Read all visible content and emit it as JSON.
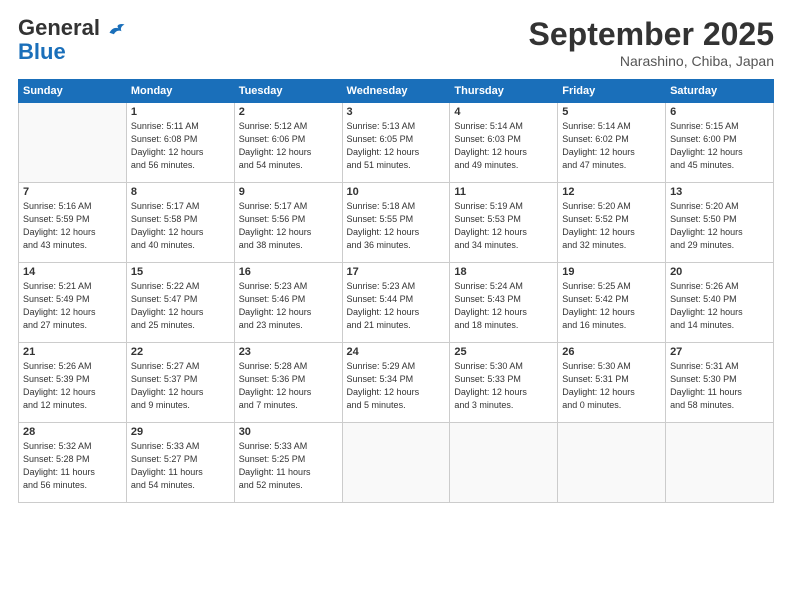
{
  "logo": {
    "general": "General",
    "blue": "Blue"
  },
  "header": {
    "month": "September 2025",
    "location": "Narashino, Chiba, Japan"
  },
  "weekdays": [
    "Sunday",
    "Monday",
    "Tuesday",
    "Wednesday",
    "Thursday",
    "Friday",
    "Saturday"
  ],
  "weeks": [
    [
      {
        "day": "",
        "info": ""
      },
      {
        "day": "1",
        "info": "Sunrise: 5:11 AM\nSunset: 6:08 PM\nDaylight: 12 hours\nand 56 minutes."
      },
      {
        "day": "2",
        "info": "Sunrise: 5:12 AM\nSunset: 6:06 PM\nDaylight: 12 hours\nand 54 minutes."
      },
      {
        "day": "3",
        "info": "Sunrise: 5:13 AM\nSunset: 6:05 PM\nDaylight: 12 hours\nand 51 minutes."
      },
      {
        "day": "4",
        "info": "Sunrise: 5:14 AM\nSunset: 6:03 PM\nDaylight: 12 hours\nand 49 minutes."
      },
      {
        "day": "5",
        "info": "Sunrise: 5:14 AM\nSunset: 6:02 PM\nDaylight: 12 hours\nand 47 minutes."
      },
      {
        "day": "6",
        "info": "Sunrise: 5:15 AM\nSunset: 6:00 PM\nDaylight: 12 hours\nand 45 minutes."
      }
    ],
    [
      {
        "day": "7",
        "info": "Sunrise: 5:16 AM\nSunset: 5:59 PM\nDaylight: 12 hours\nand 43 minutes."
      },
      {
        "day": "8",
        "info": "Sunrise: 5:17 AM\nSunset: 5:58 PM\nDaylight: 12 hours\nand 40 minutes."
      },
      {
        "day": "9",
        "info": "Sunrise: 5:17 AM\nSunset: 5:56 PM\nDaylight: 12 hours\nand 38 minutes."
      },
      {
        "day": "10",
        "info": "Sunrise: 5:18 AM\nSunset: 5:55 PM\nDaylight: 12 hours\nand 36 minutes."
      },
      {
        "day": "11",
        "info": "Sunrise: 5:19 AM\nSunset: 5:53 PM\nDaylight: 12 hours\nand 34 minutes."
      },
      {
        "day": "12",
        "info": "Sunrise: 5:20 AM\nSunset: 5:52 PM\nDaylight: 12 hours\nand 32 minutes."
      },
      {
        "day": "13",
        "info": "Sunrise: 5:20 AM\nSunset: 5:50 PM\nDaylight: 12 hours\nand 29 minutes."
      }
    ],
    [
      {
        "day": "14",
        "info": "Sunrise: 5:21 AM\nSunset: 5:49 PM\nDaylight: 12 hours\nand 27 minutes."
      },
      {
        "day": "15",
        "info": "Sunrise: 5:22 AM\nSunset: 5:47 PM\nDaylight: 12 hours\nand 25 minutes."
      },
      {
        "day": "16",
        "info": "Sunrise: 5:23 AM\nSunset: 5:46 PM\nDaylight: 12 hours\nand 23 minutes."
      },
      {
        "day": "17",
        "info": "Sunrise: 5:23 AM\nSunset: 5:44 PM\nDaylight: 12 hours\nand 21 minutes."
      },
      {
        "day": "18",
        "info": "Sunrise: 5:24 AM\nSunset: 5:43 PM\nDaylight: 12 hours\nand 18 minutes."
      },
      {
        "day": "19",
        "info": "Sunrise: 5:25 AM\nSunset: 5:42 PM\nDaylight: 12 hours\nand 16 minutes."
      },
      {
        "day": "20",
        "info": "Sunrise: 5:26 AM\nSunset: 5:40 PM\nDaylight: 12 hours\nand 14 minutes."
      }
    ],
    [
      {
        "day": "21",
        "info": "Sunrise: 5:26 AM\nSunset: 5:39 PM\nDaylight: 12 hours\nand 12 minutes."
      },
      {
        "day": "22",
        "info": "Sunrise: 5:27 AM\nSunset: 5:37 PM\nDaylight: 12 hours\nand 9 minutes."
      },
      {
        "day": "23",
        "info": "Sunrise: 5:28 AM\nSunset: 5:36 PM\nDaylight: 12 hours\nand 7 minutes."
      },
      {
        "day": "24",
        "info": "Sunrise: 5:29 AM\nSunset: 5:34 PM\nDaylight: 12 hours\nand 5 minutes."
      },
      {
        "day": "25",
        "info": "Sunrise: 5:30 AM\nSunset: 5:33 PM\nDaylight: 12 hours\nand 3 minutes."
      },
      {
        "day": "26",
        "info": "Sunrise: 5:30 AM\nSunset: 5:31 PM\nDaylight: 12 hours\nand 0 minutes."
      },
      {
        "day": "27",
        "info": "Sunrise: 5:31 AM\nSunset: 5:30 PM\nDaylight: 11 hours\nand 58 minutes."
      }
    ],
    [
      {
        "day": "28",
        "info": "Sunrise: 5:32 AM\nSunset: 5:28 PM\nDaylight: 11 hours\nand 56 minutes."
      },
      {
        "day": "29",
        "info": "Sunrise: 5:33 AM\nSunset: 5:27 PM\nDaylight: 11 hours\nand 54 minutes."
      },
      {
        "day": "30",
        "info": "Sunrise: 5:33 AM\nSunset: 5:25 PM\nDaylight: 11 hours\nand 52 minutes."
      },
      {
        "day": "",
        "info": ""
      },
      {
        "day": "",
        "info": ""
      },
      {
        "day": "",
        "info": ""
      },
      {
        "day": "",
        "info": ""
      }
    ]
  ]
}
